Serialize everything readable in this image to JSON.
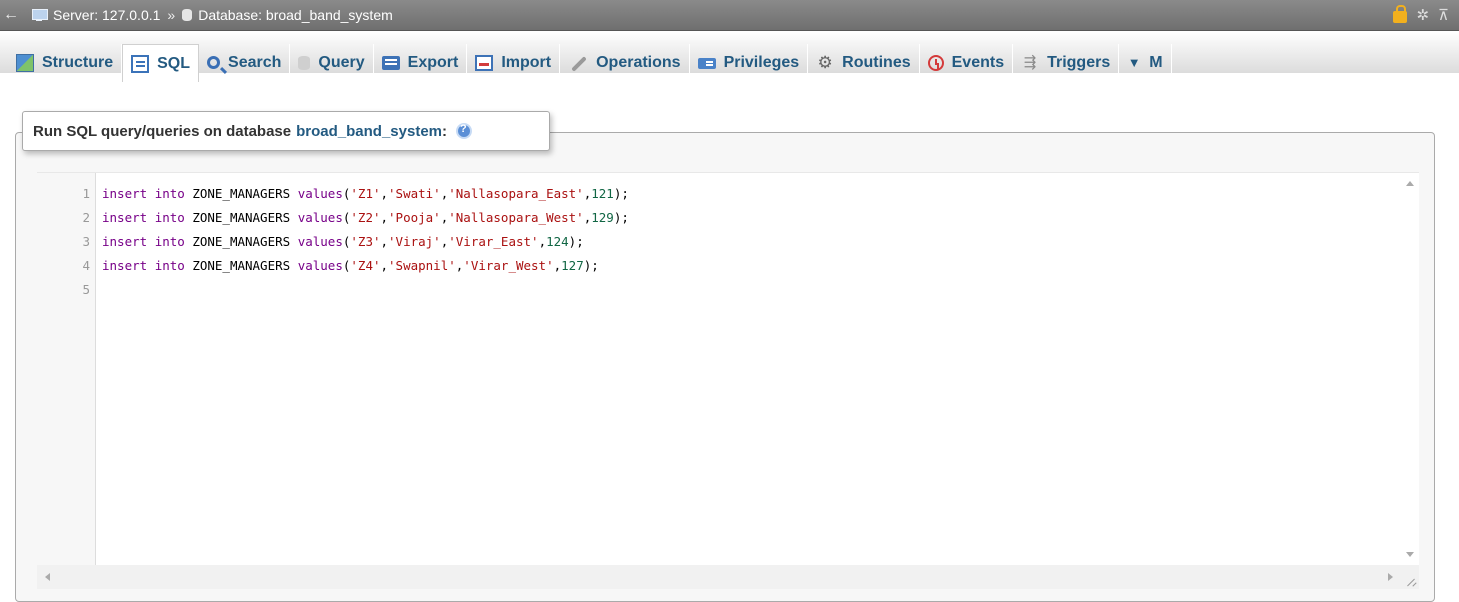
{
  "topbar": {
    "back_icon": "arrow-left-icon",
    "server_label": "Server: 127.0.0.1",
    "separator": "»",
    "database_label": "Database: broad_band_system",
    "right_icons": [
      "lock-icon",
      "gear-icon",
      "collapse-icon"
    ]
  },
  "tabs": [
    {
      "label": "Structure",
      "icon": "structure-icon"
    },
    {
      "label": "SQL",
      "icon": "sql-icon",
      "active": true
    },
    {
      "label": "Search",
      "icon": "search-icon"
    },
    {
      "label": "Query",
      "icon": "query-icon"
    },
    {
      "label": "Export",
      "icon": "export-icon"
    },
    {
      "label": "Import",
      "icon": "import-icon"
    },
    {
      "label": "Operations",
      "icon": "wrench-icon"
    },
    {
      "label": "Privileges",
      "icon": "privileges-icon"
    },
    {
      "label": "Routines",
      "icon": "routines-icon"
    },
    {
      "label": "Events",
      "icon": "clock-icon"
    },
    {
      "label": "Triggers",
      "icon": "triggers-icon"
    },
    {
      "label": "M",
      "icon": "more-dropdown-icon"
    }
  ],
  "panel": {
    "legend_prefix": "Run SQL query/queries on database",
    "database": "broad_band_system",
    "legend_suffix": ":"
  },
  "editor": {
    "line_numbers": [
      "1",
      "2",
      "3",
      "4",
      "5"
    ],
    "lines": [
      {
        "kw1": "insert",
        "kw2": "into",
        "table": "ZONE_MANAGERS",
        "kw3": "values",
        "a": "'Z1'",
        "b": "'Swati'",
        "c": "'Nallasopara_East'",
        "n": "121"
      },
      {
        "kw1": "insert",
        "kw2": "into",
        "table": "ZONE_MANAGERS",
        "kw3": "values",
        "a": "'Z2'",
        "b": "'Pooja'",
        "c": "'Nallasopara_West'",
        "n": "129"
      },
      {
        "kw1": "insert",
        "kw2": "into",
        "table": "ZONE_MANAGERS",
        "kw3": "values",
        "a": "'Z3'",
        "b": "'Viraj'",
        "c": "'Virar_East'",
        "n": "124"
      },
      {
        "kw1": "insert",
        "kw2": "into",
        "table": "ZONE_MANAGERS",
        "kw3": "values",
        "a": "'Z4'",
        "b": "'Swapnil'",
        "c": "'Virar_West'",
        "n": "127"
      }
    ]
  },
  "colors": {
    "topbar": "#7d7d7d",
    "link": "#235a81",
    "keyword": "#770088",
    "string": "#aa1111",
    "number": "#116644"
  }
}
